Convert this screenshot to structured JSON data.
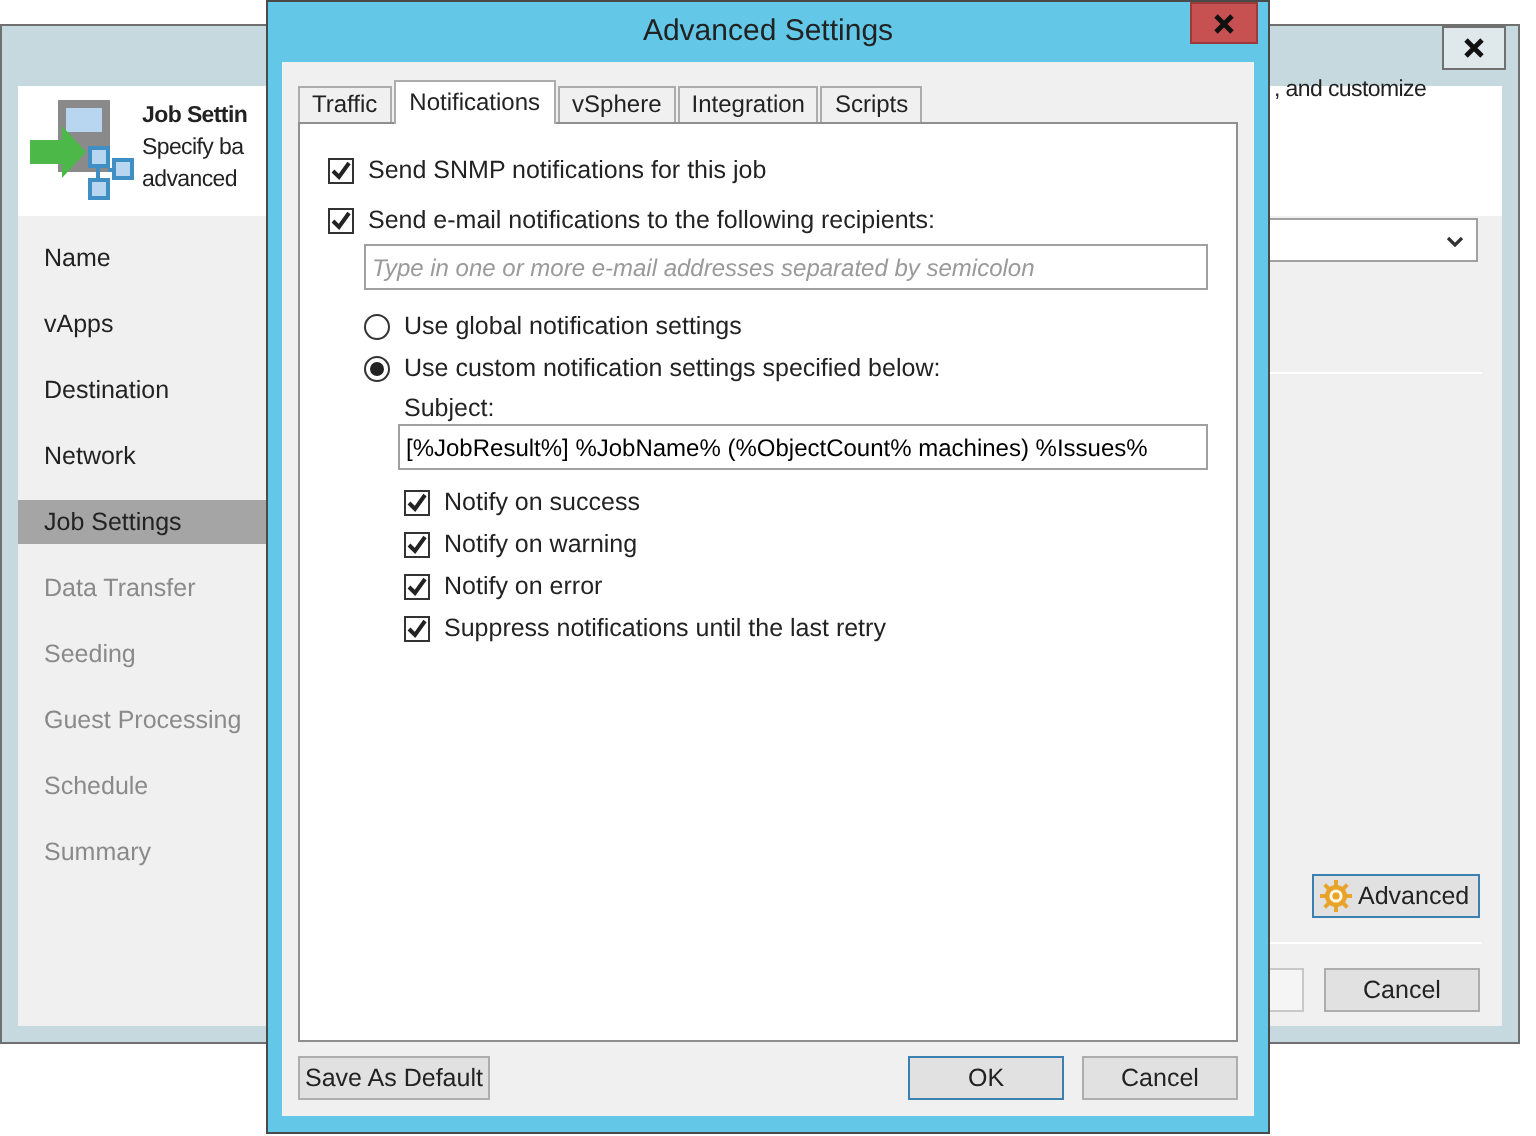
{
  "background_window": {
    "header": {
      "title": "Job Settin",
      "description_lines": [
        "Specify ba",
        "advanced"
      ],
      "description_right": ", and customize"
    },
    "sidebar": {
      "items": [
        {
          "label": "Name",
          "selected": false,
          "disabled": false
        },
        {
          "label": "vApps",
          "selected": false,
          "disabled": false
        },
        {
          "label": "Destination",
          "selected": false,
          "disabled": false
        },
        {
          "label": "Network",
          "selected": false,
          "disabled": false
        },
        {
          "label": "Job Settings",
          "selected": true,
          "disabled": false
        },
        {
          "label": "Data Transfer",
          "selected": false,
          "disabled": true
        },
        {
          "label": "Seeding",
          "selected": false,
          "disabled": true
        },
        {
          "label": "Guest Processing",
          "selected": false,
          "disabled": true
        },
        {
          "label": "Schedule",
          "selected": false,
          "disabled": true
        },
        {
          "label": "Summary",
          "selected": false,
          "disabled": true
        }
      ]
    },
    "advanced_button": "Advanced",
    "cancel_button": "Cancel"
  },
  "dialog": {
    "title": "Advanced Settings",
    "tabs": [
      {
        "label": "Traffic",
        "selected": false
      },
      {
        "label": "Notifications",
        "selected": true
      },
      {
        "label": "vSphere",
        "selected": false
      },
      {
        "label": "Integration",
        "selected": false
      },
      {
        "label": "Scripts",
        "selected": false
      }
    ],
    "snmp": {
      "label": "Send SNMP notifications for this job",
      "checked": true
    },
    "email": {
      "label": "Send e-mail notifications to the following recipients:",
      "checked": true,
      "placeholder": "Type in one or more e-mail addresses separated by semicolon"
    },
    "radios": [
      {
        "label": "Use global notification settings",
        "selected": false
      },
      {
        "label": "Use custom notification settings specified below:",
        "selected": true
      }
    ],
    "subject": {
      "label": "Subject:",
      "value": "[%JobResult%] %JobName% (%ObjectCount% machines) %Issues%"
    },
    "notify": [
      {
        "label": "Notify on success",
        "checked": true
      },
      {
        "label": "Notify on warning",
        "checked": true
      },
      {
        "label": "Notify on error",
        "checked": true
      },
      {
        "label": "Suppress notifications until the last retry",
        "checked": true
      }
    ],
    "save_default_button": "Save As Default",
    "ok_button": "OK",
    "cancel_button": "Cancel"
  }
}
